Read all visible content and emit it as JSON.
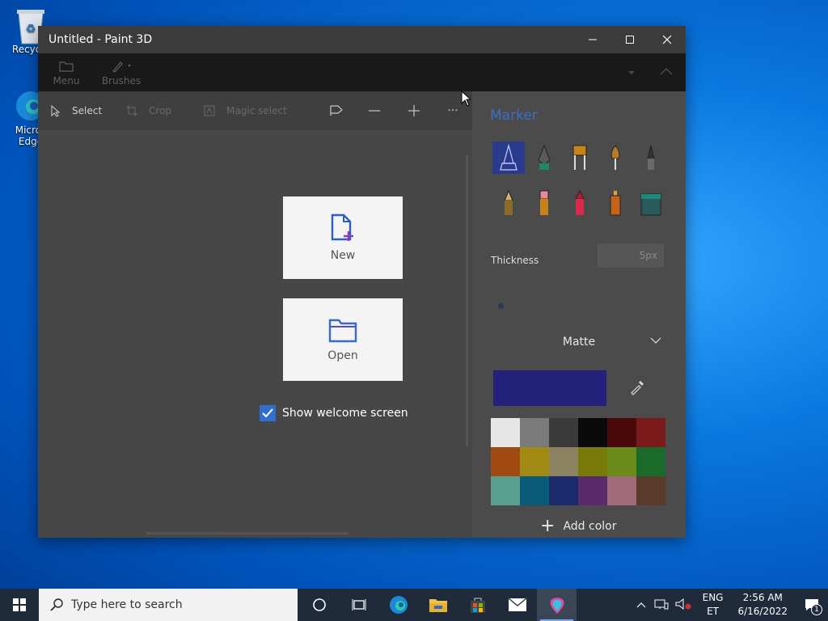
{
  "desktop": {
    "icons": [
      {
        "label": "Recycle",
        "icon": "recycle-bin-icon"
      },
      {
        "label": "Micros Edge",
        "icon": "edge-icon"
      }
    ]
  },
  "window": {
    "title": "Untitled - Paint 3D",
    "controls": {
      "minimize": "minimize-icon",
      "maximize": "maximize-icon",
      "close": "close-icon"
    }
  },
  "ribbon": {
    "items": [
      {
        "label": "Menu",
        "icon": "folder-icon"
      },
      {
        "label": "Brushes",
        "icon": "brush-icon"
      }
    ]
  },
  "toolbar": {
    "select_label": "Select",
    "crop_label": "Crop",
    "magic_select_label": "Magic select",
    "more_label": "···"
  },
  "panel": {
    "title": "Marker",
    "brushes": [
      "marker",
      "calligraphy-pen",
      "oil-brush",
      "watercolor",
      "pixel-pen",
      "pencil",
      "eraser",
      "crayon",
      "spray-can",
      "fill"
    ],
    "thickness_label": "Thickness",
    "thickness_value": "5px",
    "finish": "Matte",
    "current_color": "#22227a",
    "palette": [
      "#e6e6e6",
      "#7a7a7a",
      "#3a3a3a",
      "#0a0a0a",
      "#4a0a0a",
      "#7a1a1a",
      "#a04a12",
      "#a08a14",
      "#8a8260",
      "#7a7a0a",
      "#6a8a1a",
      "#1a6a2a",
      "#5aa090",
      "#0a5a7a",
      "#1a2a6a",
      "#5a2a6a",
      "#a06a7a",
      "#5a3a2a"
    ],
    "add_color_label": "Add color"
  },
  "welcome": {
    "new_label": "New",
    "open_label": "Open",
    "show_welcome_label": "Show welcome screen",
    "show_welcome_checked": true
  },
  "taskbar": {
    "search_placeholder": "Type here to search",
    "language": "ENG",
    "region": "ET",
    "time": "2:56 AM",
    "date": "6/16/2022",
    "notification_count": "1"
  }
}
